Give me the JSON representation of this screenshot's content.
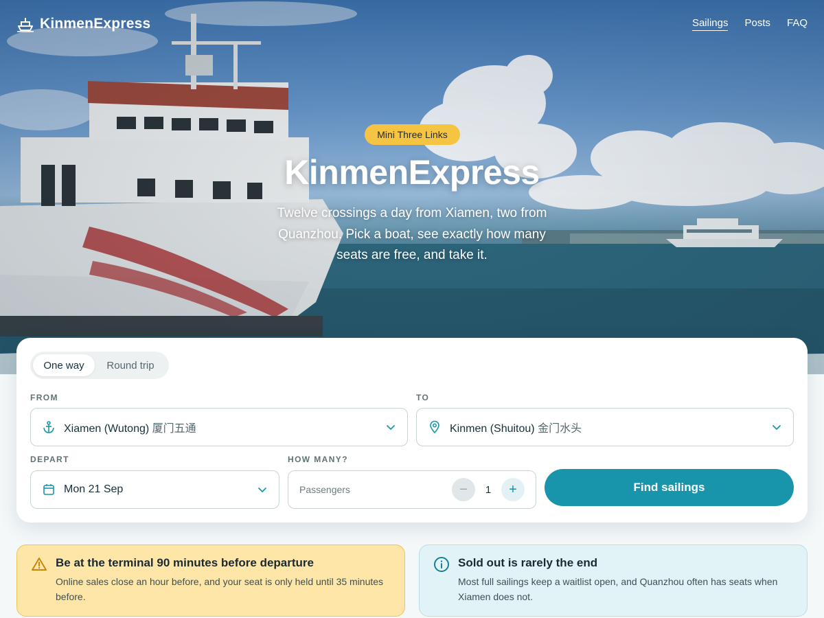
{
  "nav": {
    "brand": "KinmenExpress",
    "links": [
      {
        "label": "Sailings",
        "active": true
      },
      {
        "label": "Posts",
        "active": false
      },
      {
        "label": "FAQ",
        "active": false
      }
    ]
  },
  "hero": {
    "badge": "Mini Three Links",
    "title": "KinmenExpress",
    "subtitle": "Twelve crossings a day from Xiamen, two from Quanzhou. Pick a boat, see exactly how many seats are free, and take it."
  },
  "search": {
    "trip_types": {
      "one_way": "One way",
      "round_trip": "Round trip",
      "selected": "One way"
    },
    "from": {
      "label": "FROM",
      "value": "Xiamen (Wutong)",
      "value_zh": "厦门五通",
      "icon": "anchor-icon"
    },
    "to": {
      "label": "TO",
      "value": "Kinmen (Shuitou)",
      "value_zh": "金门水头",
      "icon": "map-pin-icon"
    },
    "depart": {
      "label": "DEPART",
      "value": "Mon 21 Sep",
      "icon": "calendar-icon"
    },
    "how_many": {
      "label": "HOW MANY?",
      "placeholder": "Passengers",
      "count": "1",
      "minus": "−",
      "plus": "+"
    },
    "submit": "Find sailings"
  },
  "notices": {
    "warning": {
      "title": "Be at the terminal 90 minutes before departure",
      "body": "Online sales close an hour before, and your seat is only held until 35 minutes before.",
      "icon": "warning-triangle-icon"
    },
    "info": {
      "title": "Sold out is rarely the end",
      "body": "Most full sailings keep a waitlist open, and Quanzhou often has seats when Xiamen does not.",
      "icon": "info-circle-icon"
    }
  },
  "colors": {
    "accent": "#1995ab",
    "badge": "#f6c443",
    "warning_bg": "#fde6a8",
    "info_bg": "#e2f3f7"
  }
}
